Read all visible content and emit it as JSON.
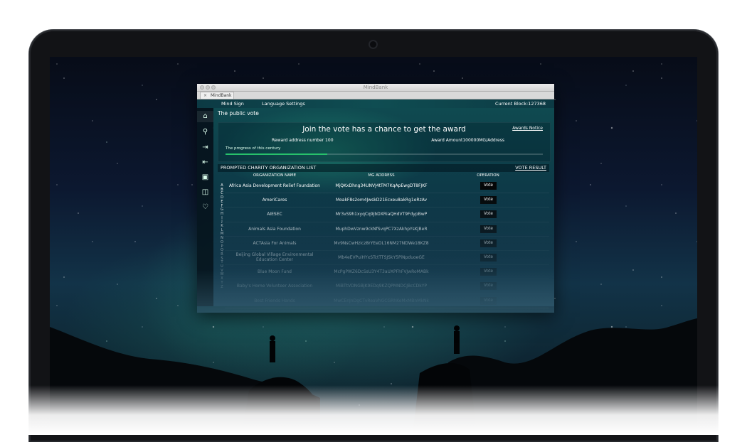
{
  "window": {
    "title": "MindBank",
    "tab_label": "MindBank",
    "tab_close": "×"
  },
  "menu": {
    "mind_sign": "Mind Sign",
    "language_settings": "Language Settings",
    "current_block": "Current Block:127368"
  },
  "sidebar": {
    "items": [
      {
        "icon": "home-icon",
        "glyph": "⌂"
      },
      {
        "icon": "wallet-icon",
        "glyph": "⚲"
      },
      {
        "icon": "export-icon",
        "glyph": "⇥"
      },
      {
        "icon": "import-icon",
        "glyph": "⇤"
      },
      {
        "icon": "document-icon",
        "glyph": "▣"
      },
      {
        "icon": "gift-icon",
        "glyph": "◫"
      },
      {
        "icon": "heart-icon",
        "glyph": "♡"
      }
    ]
  },
  "page": {
    "title": "The public vote"
  },
  "award": {
    "headline": "Join the vote has a chance to get the award",
    "notice_link": "Awards Notice",
    "reward_address": "Reward address number 100",
    "amount": "Award Amount100000MG/Address",
    "progress_label": "The progress of this century",
    "progress_fraction": 0.32
  },
  "list": {
    "title": "PROMPTED CHARITY ORGANIZATION LIST",
    "vote_result_link": "VOTE RESULT",
    "columns": [
      "ORGANIZATION NAME",
      "MG ADDRESS",
      "OPERATION"
    ],
    "alphabet": [
      "A",
      "B",
      "C",
      "D",
      "E",
      "F",
      "G",
      "H",
      "I",
      "J",
      "K",
      "L",
      "M",
      "N",
      "O",
      "P",
      "Q",
      "R",
      "S",
      "T",
      "U",
      "V",
      "W",
      "X",
      "Y",
      "Z"
    ],
    "vote_label": "Vote",
    "rows": [
      {
        "name": "Africa Asia Development Relief Foundation",
        "address": "MjQKxDhng34UNVJ4tTM7KqApEwgDT8FJKF"
      },
      {
        "name": "AmeriCares",
        "address": "MoakF8s2om4JwskD21Ecxeu8akRg1eRzAv"
      },
      {
        "name": "AIESEC",
        "address": "Mr3vS9h1xyqCq9jbDXRiaQHdVT9FdypBwP"
      },
      {
        "name": "Animals Asia Foundation",
        "address": "MuphDwVznw9ckNfSvqPC7XzAkhpYsKJBeR"
      },
      {
        "name": "ACTAsia For Animals",
        "address": "Mv9NsCwHzicz8rYEeDL16NM27NDWe18KZ8"
      },
      {
        "name": "Beijing Global Village Environmental Education Center",
        "address": "Mb4eEVPuiHYxSTctTTSJSkY5PiNpduoeGE"
      },
      {
        "name": "Blue Moon Fund",
        "address": "McPgPWZ6DcSsU3Y4T3aUXPFhFVJwRoMABk"
      },
      {
        "name": "Baby's Home Volunteer Association",
        "address": "MiBTtVDNGBjK9EDq9KZQPMNDCJBcCDkYP"
      },
      {
        "name": "Best Friends Hands",
        "address": "MwCEnJnDgCTvReaVhGCGRhKeMxMBnMkNk"
      }
    ]
  }
}
